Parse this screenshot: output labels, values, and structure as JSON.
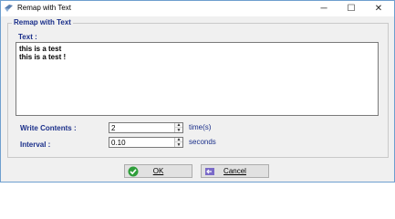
{
  "window": {
    "title": "Remap with Text",
    "controls": {
      "minimize": "─",
      "maximize": "☐",
      "close": "✕"
    }
  },
  "group": {
    "legend": "Remap with Text"
  },
  "text_field": {
    "label": "Text :",
    "value": "this is a test\nthis is a test !"
  },
  "write_contents": {
    "label": "Write Contents :",
    "value": "2",
    "unit": "time(s)"
  },
  "interval": {
    "label": "Interval  :",
    "value": "0.10",
    "unit": "seconds"
  },
  "buttons": {
    "ok": {
      "label": "OK",
      "icon": "checkmark-icon"
    },
    "cancel": {
      "label": "Cancel",
      "icon": "cancel-arrow-icon"
    }
  },
  "colors": {
    "label_blue": "#1a2f8a",
    "ok_green": "#2e9e3a",
    "cancel_purple": "#6a5acd"
  }
}
